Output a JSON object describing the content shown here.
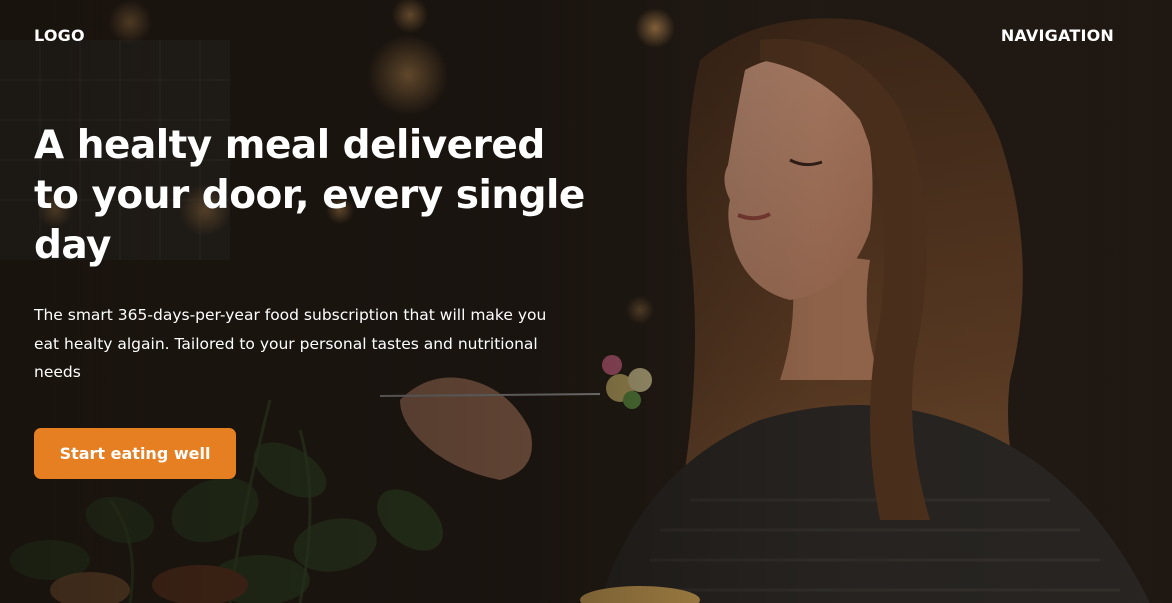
{
  "header": {
    "logo": "LOGO",
    "navigation": "NAVIGATION"
  },
  "hero": {
    "title": "A healty meal delivered to your door, every single day",
    "subtitle": "The smart 365-days-per-year food subscription that will make you eat healty algain. Tailored to your personal tastes and nutritional needs",
    "cta_label": "Start eating well"
  },
  "colors": {
    "accent": "#e67e22",
    "text": "#ffffff"
  }
}
